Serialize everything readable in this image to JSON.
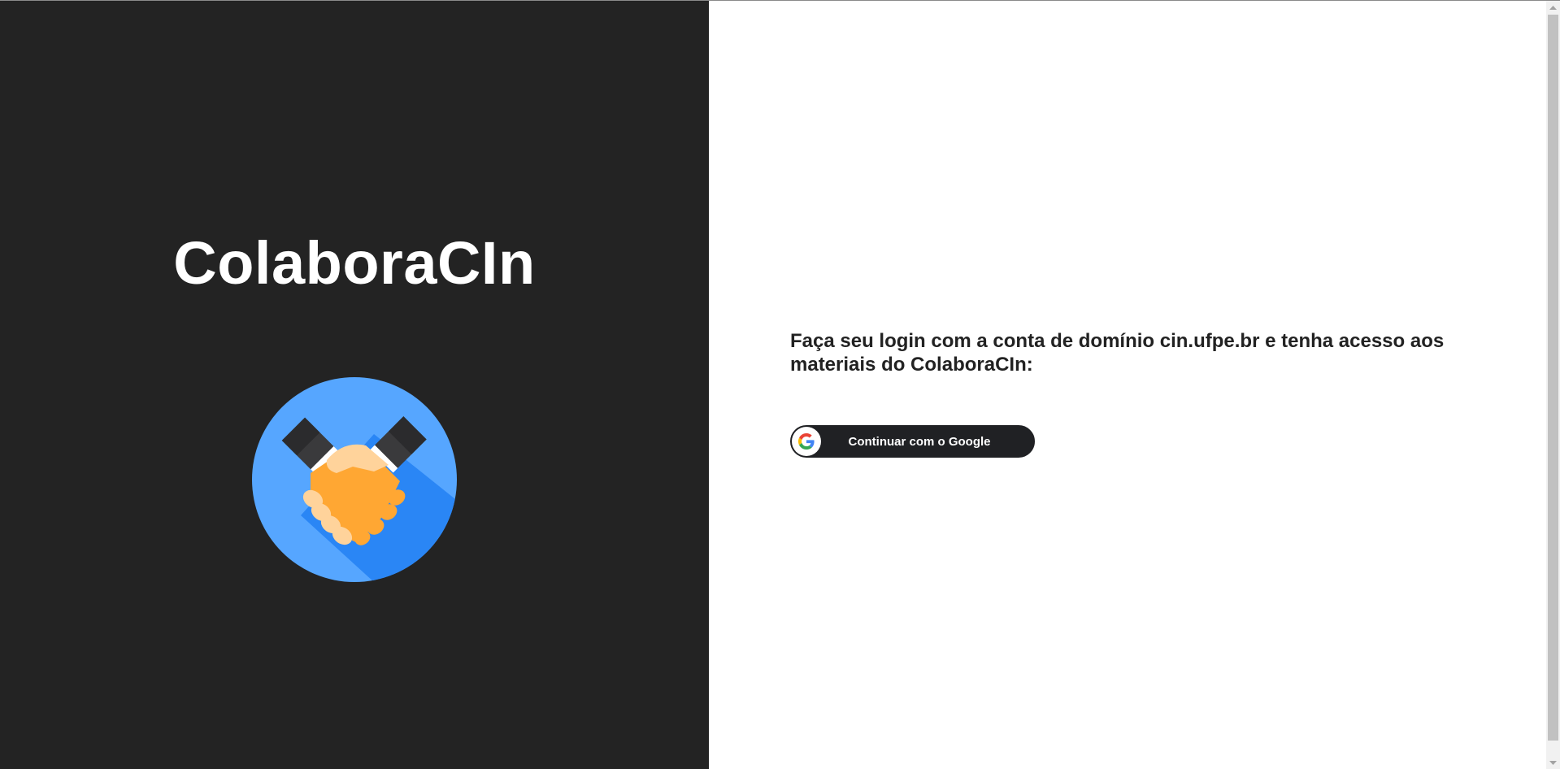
{
  "brand": {
    "title": "ColaboraCIn",
    "logo_icon": "handshake-icon"
  },
  "login": {
    "instructions": "Faça seu login com a conta de domínio cin.ufpe.br e tenha acesso aos materiais do ColaboraCIn:",
    "google_button_label": "Continuar com o Google",
    "google_icon": "google-g-icon"
  },
  "colors": {
    "left_panel_bg": "#232323",
    "right_panel_bg": "#ffffff",
    "button_bg": "#202124",
    "logo_circle": "#4da3ff",
    "hand_orange": "#ffa733",
    "hand_light": "#ffd39b",
    "sleeve_dark": "#3c3c3c"
  }
}
